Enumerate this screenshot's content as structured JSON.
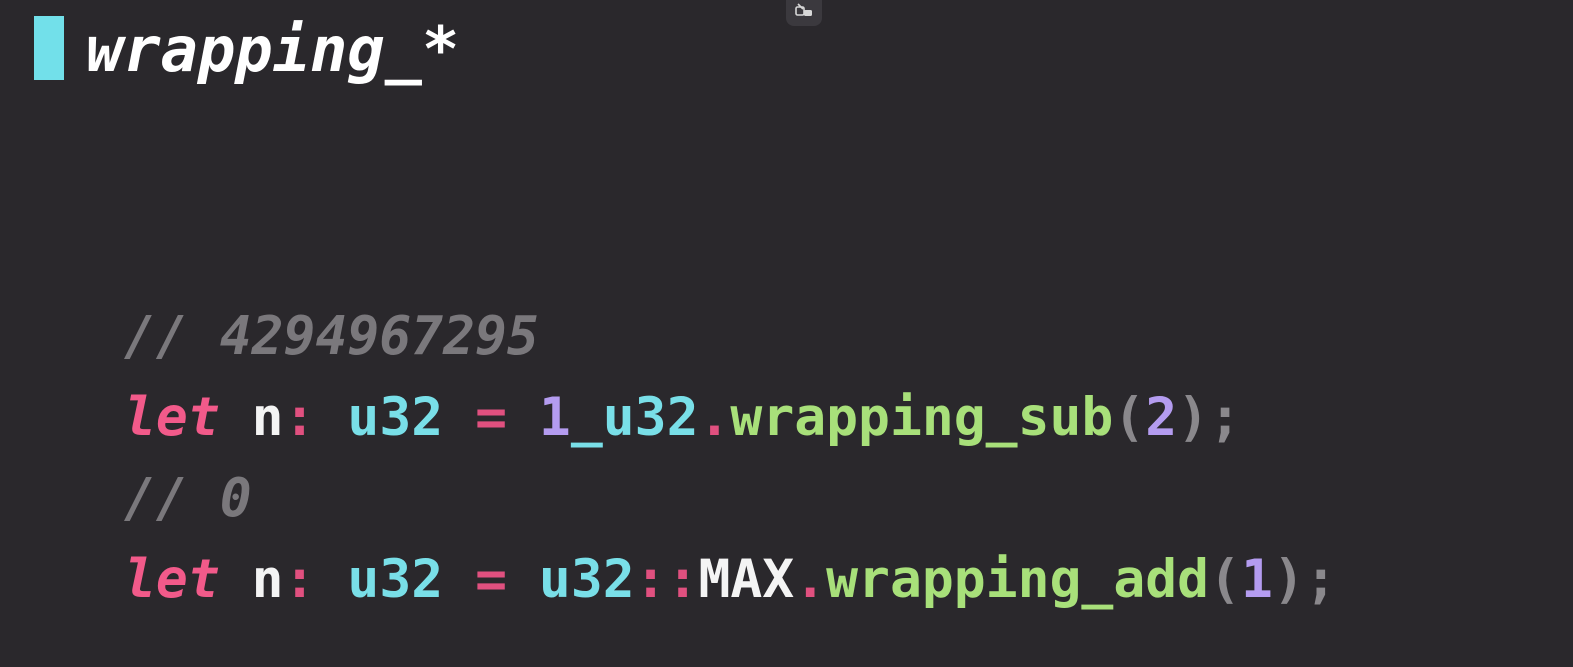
{
  "slide": {
    "title": "wrapping_*"
  },
  "code": {
    "line1": {
      "comment": "// 4294967295"
    },
    "line2": {
      "kw": "let",
      "ident": "n",
      "colon": ":",
      "type": "u32",
      "eq": "=",
      "num": "1",
      "underscore_type": "_u32",
      "dot": ".",
      "method": "wrapping_sub",
      "open": "(",
      "arg": "2",
      "close": ")",
      "semi": ";"
    },
    "line3": {
      "comment": "// 0"
    },
    "line4": {
      "kw": "let",
      "ident": "n",
      "colon": ":",
      "type": "u32",
      "eq": "=",
      "type2": "u32",
      "path_sep": "::",
      "const": "MAX",
      "dot": ".",
      "method": "wrapping_add",
      "open": "(",
      "arg": "1",
      "close": ")",
      "semi": ";"
    }
  },
  "colors": {
    "background": "#2a282c",
    "accent": "#72e0ea",
    "keyword": "#f25a8a",
    "type": "#79dfe8",
    "number": "#b49cf0",
    "method": "#a8e07a",
    "comment": "#7a787c"
  },
  "icons": {
    "corner": "screen-share-icon"
  }
}
